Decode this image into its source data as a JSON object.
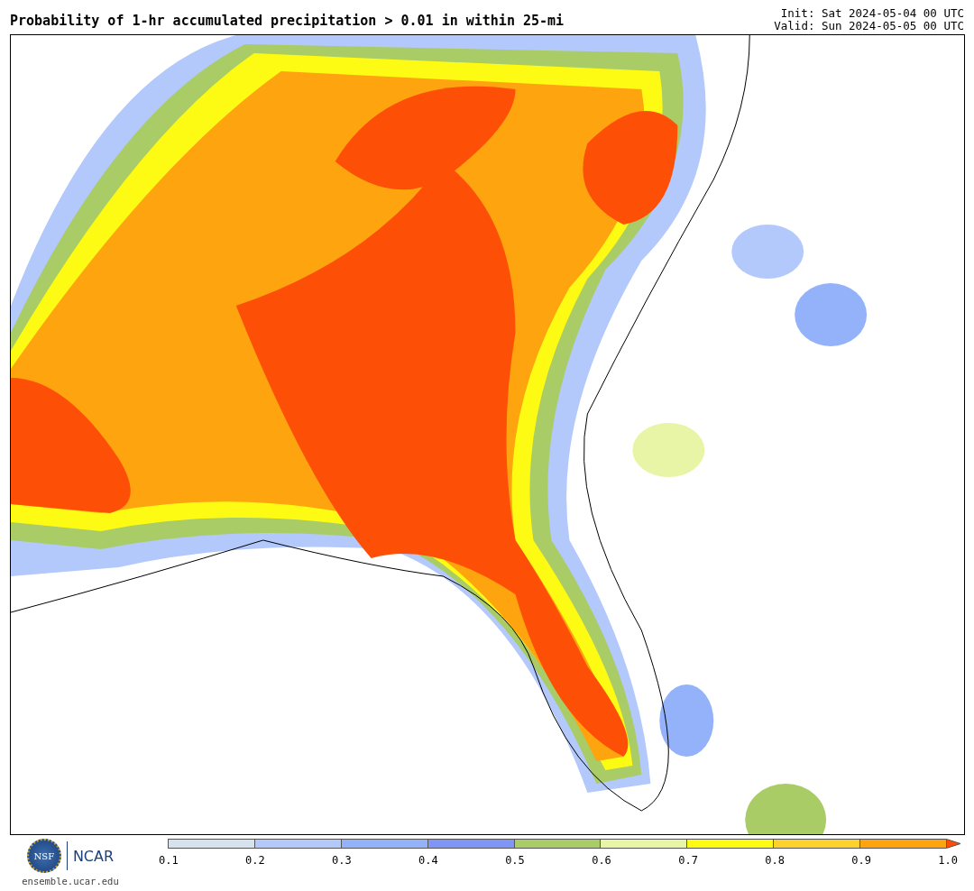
{
  "title": "Probability of 1-hr accumulated precipitation > 0.01 in within 25-mi",
  "init": "Init: Sat 2024-05-04 00 UTC",
  "valid": "Valid: Sun 2024-05-05 00 UTC",
  "logos": {
    "nsf": "NSF",
    "ncar": "NCAR",
    "site": "ensemble.ucar.edu"
  },
  "colorbar": {
    "segments": [
      {
        "color": "#d6e2ee"
      },
      {
        "color": "#b3c8fb"
      },
      {
        "color": "#93b2f9"
      },
      {
        "color": "#7f96f7"
      },
      {
        "color": "#a9cc66"
      },
      {
        "color": "#e9f5a6"
      },
      {
        "color": "#fdfb14"
      },
      {
        "color": "#fdd12c"
      },
      {
        "color": "#fda40e"
      },
      {
        "color": "#fd4f05",
        "kind": "arrow"
      }
    ],
    "ticks": [
      "0.1",
      "0.2",
      "0.3",
      "0.4",
      "0.5",
      "0.6",
      "0.7",
      "0.8",
      "0.9",
      "1.0"
    ]
  }
}
